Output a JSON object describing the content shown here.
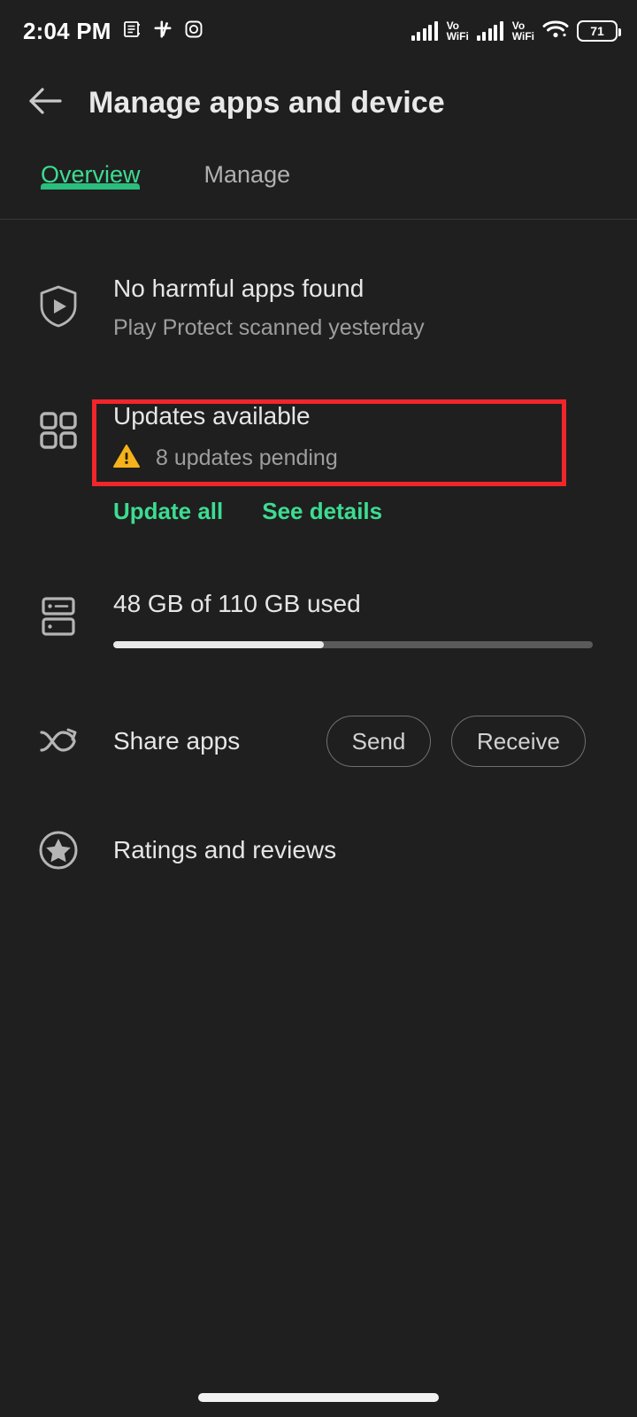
{
  "status_bar": {
    "time": "2:04 PM",
    "notification_icons": [
      "news-icon",
      "slack-icon",
      "instagram-icon"
    ],
    "signal_1": {
      "label_top": "Vo",
      "label_bottom": "WiFi",
      "bars": 5
    },
    "signal_2": {
      "label_top": "Vo",
      "label_bottom": "WiFi",
      "bars": 5
    },
    "wifi_icon": "wifi-icon",
    "battery_level": "71"
  },
  "appbar": {
    "back_icon": "back-arrow-icon",
    "title": "Manage apps and device"
  },
  "tabs": [
    {
      "label": "Overview",
      "active": true
    },
    {
      "label": "Manage",
      "active": false
    }
  ],
  "play_protect": {
    "icon": "play-protect-shield-icon",
    "title": "No harmful apps found",
    "subtitle": "Play Protect scanned yesterday"
  },
  "updates": {
    "icon": "apps-grid-icon",
    "title": "Updates available",
    "warning_icon": "warning-triangle-icon",
    "subtitle": "8 updates pending",
    "highlight_color": "#f2252b",
    "actions": [
      {
        "label": "Update all"
      },
      {
        "label": "See details"
      }
    ]
  },
  "storage": {
    "icon": "storage-icon",
    "text": "48 GB of 110 GB used",
    "used_gb": 48,
    "total_gb": 110,
    "percent_used": 44
  },
  "share_apps": {
    "icon": "share-apps-icon",
    "label": "Share apps",
    "send_label": "Send",
    "receive_label": "Receive"
  },
  "ratings": {
    "icon": "star-circle-icon",
    "label": "Ratings and reviews"
  },
  "colors": {
    "background": "#1f1f1f",
    "accent_green": "#3ddc91",
    "indicator_green": "#2bbd7e",
    "warning_amber": "#f5b21a",
    "highlight_red": "#f2252b"
  }
}
